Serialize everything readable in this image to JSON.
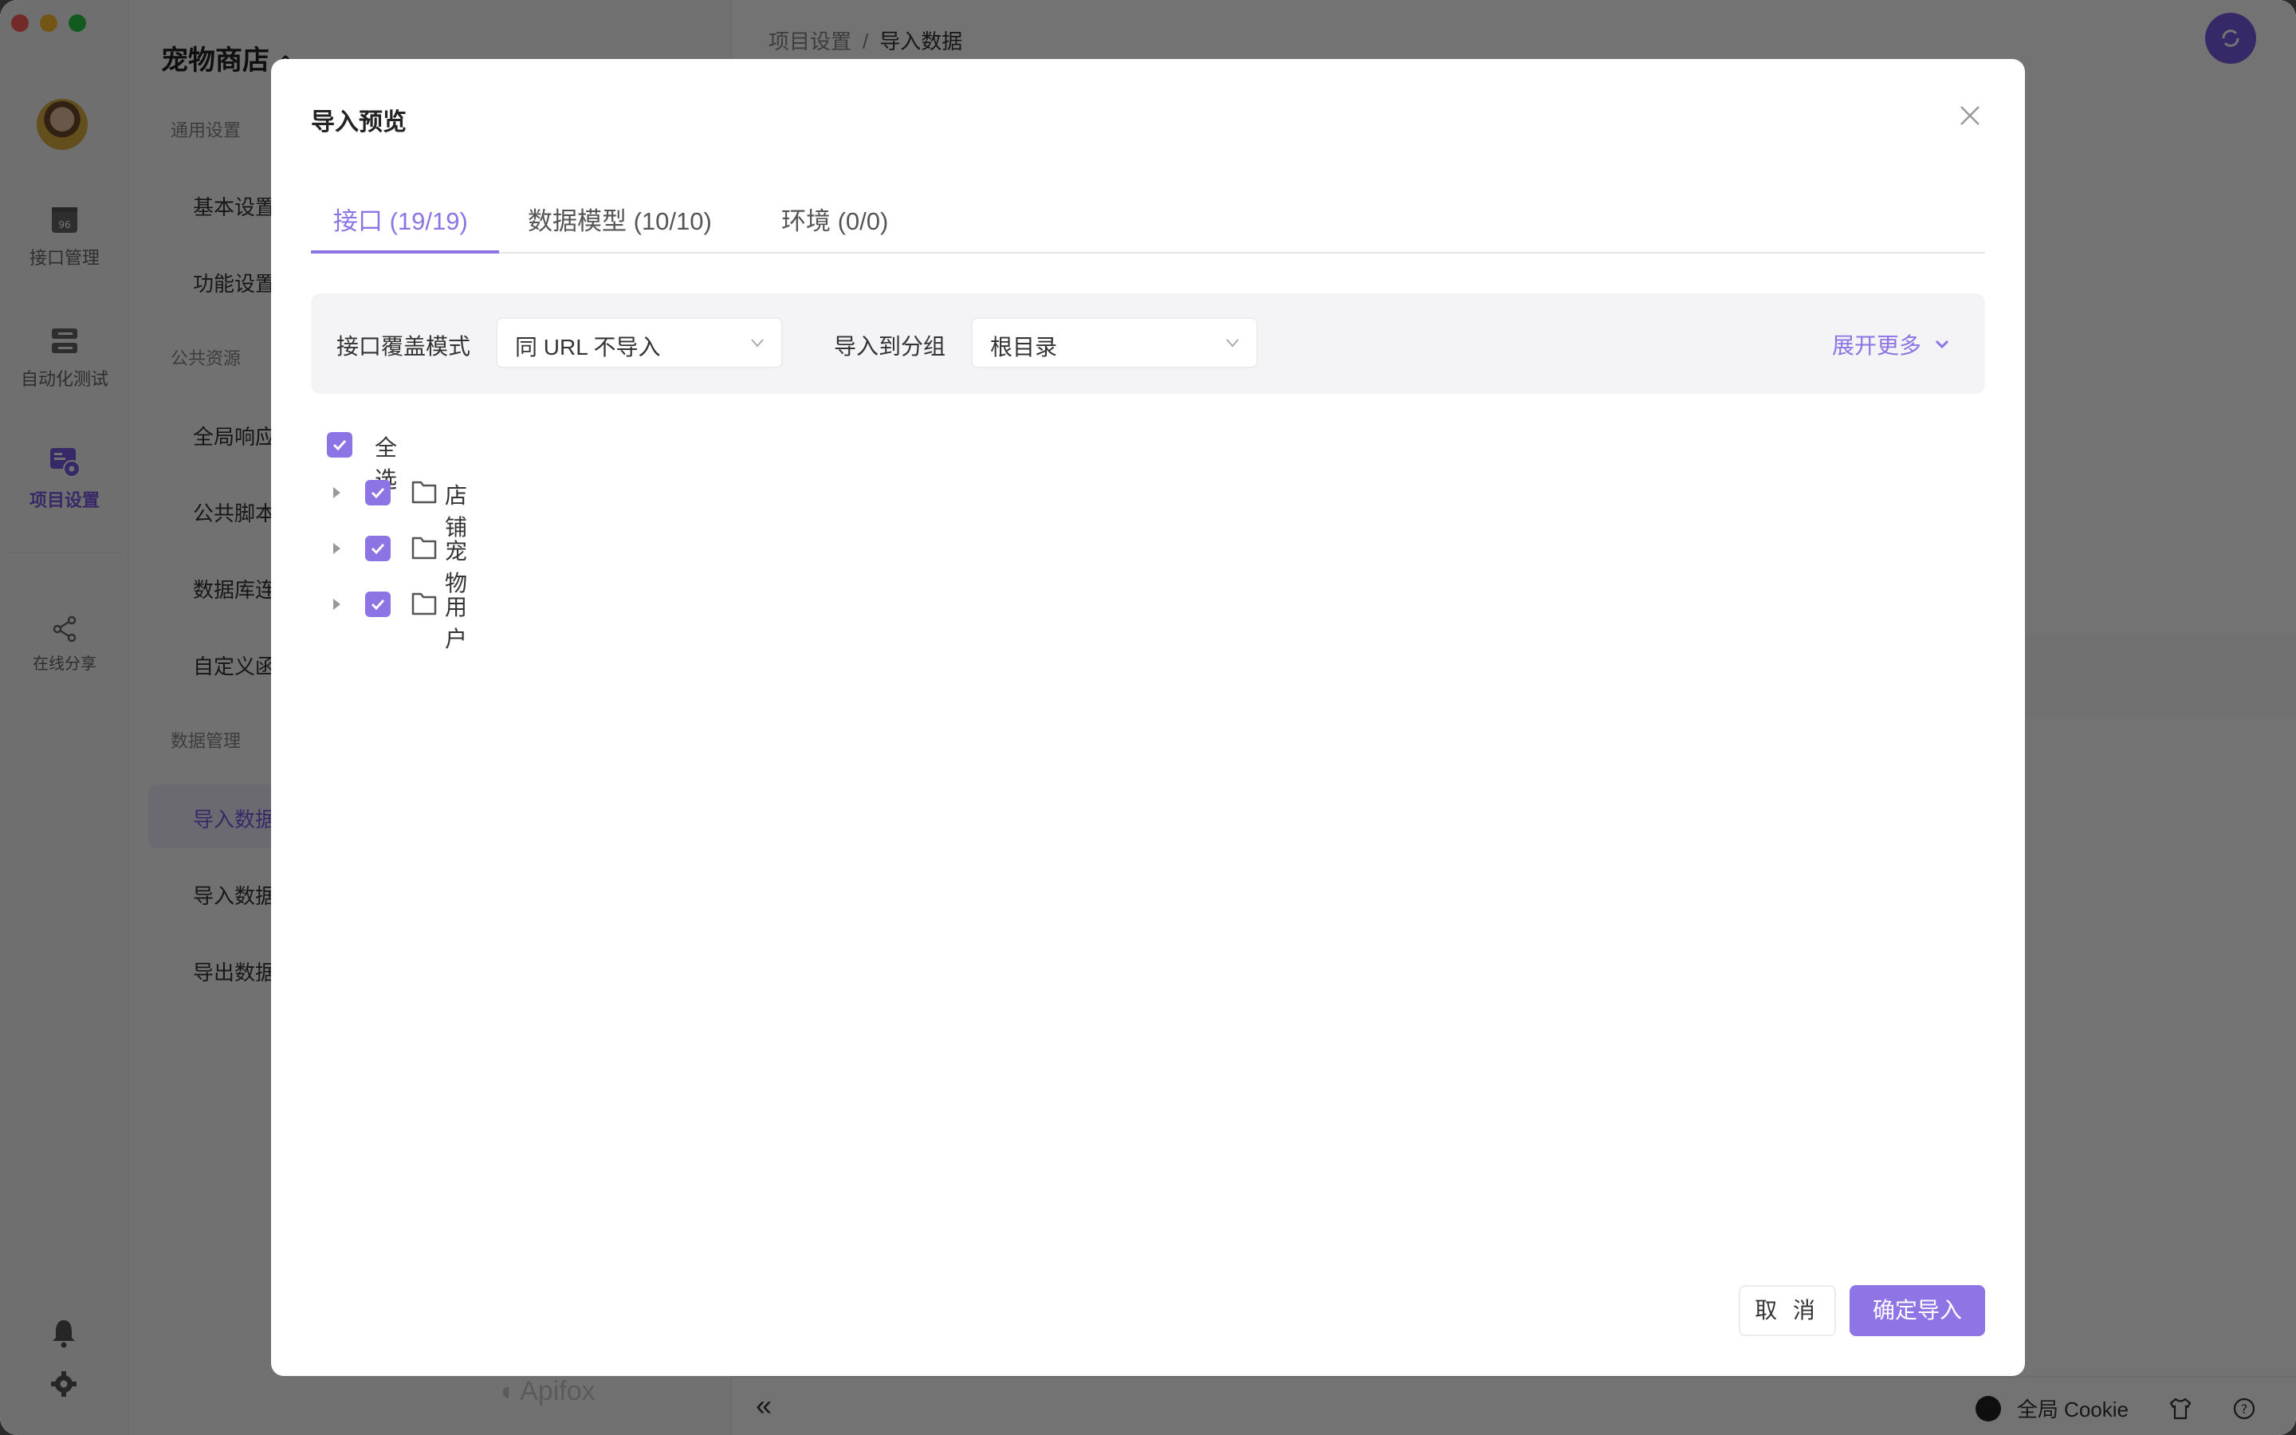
{
  "window": {
    "project_name": "宠物商店",
    "accent_color": "#8c74e4"
  },
  "rail": {
    "items": [
      {
        "label": "接口管理",
        "icon": "api-icon",
        "active": false
      },
      {
        "label": "自动化测试",
        "icon": "server-stack-icon",
        "active": false
      },
      {
        "label": "项目设置",
        "icon": "project-settings-icon",
        "active": true
      },
      {
        "label": "在线分享",
        "icon": "share-icon",
        "active": false
      }
    ],
    "bottom_icons": [
      "bell-icon",
      "gear-icon"
    ]
  },
  "sidebar": {
    "groups": [
      {
        "title": "通用设置",
        "items": [
          "基本设置",
          "功能设置"
        ]
      },
      {
        "title": "公共资源",
        "items": [
          "全局响应",
          "公共脚本",
          "数据库连接",
          "自定义函数"
        ]
      },
      {
        "title": "数据管理",
        "items": [
          "导入数据",
          "导入数据",
          "导出数据"
        ]
      }
    ],
    "active_item": "导入数据",
    "logo_text": "Apifox"
  },
  "header": {
    "breadcrumb": [
      "项目设置",
      "导入数据"
    ],
    "breadcrumb_sep": "/"
  },
  "statusbar": {
    "collapse_label": "«",
    "cookie_label": "全局 Cookie"
  },
  "modal": {
    "title": "导入预览",
    "tabs": [
      {
        "label": "接口 (19/19)",
        "active": true
      },
      {
        "label": "数据模型 (10/10)",
        "active": false
      },
      {
        "label": "环境 (0/0)",
        "active": false
      }
    ],
    "filters": {
      "override_label": "接口覆盖模式",
      "override_value": "同 URL 不导入",
      "group_label": "导入到分组",
      "group_value": "根目录",
      "expand_more": "展开更多"
    },
    "select_all": {
      "label": "全选",
      "checked": true
    },
    "tree": [
      {
        "label": "店铺",
        "checked": true,
        "expanded": false
      },
      {
        "label": "宠物",
        "checked": true,
        "expanded": false
      },
      {
        "label": "用户",
        "checked": true,
        "expanded": false
      }
    ],
    "cancel_label": "取 消",
    "confirm_label": "确定导入"
  }
}
